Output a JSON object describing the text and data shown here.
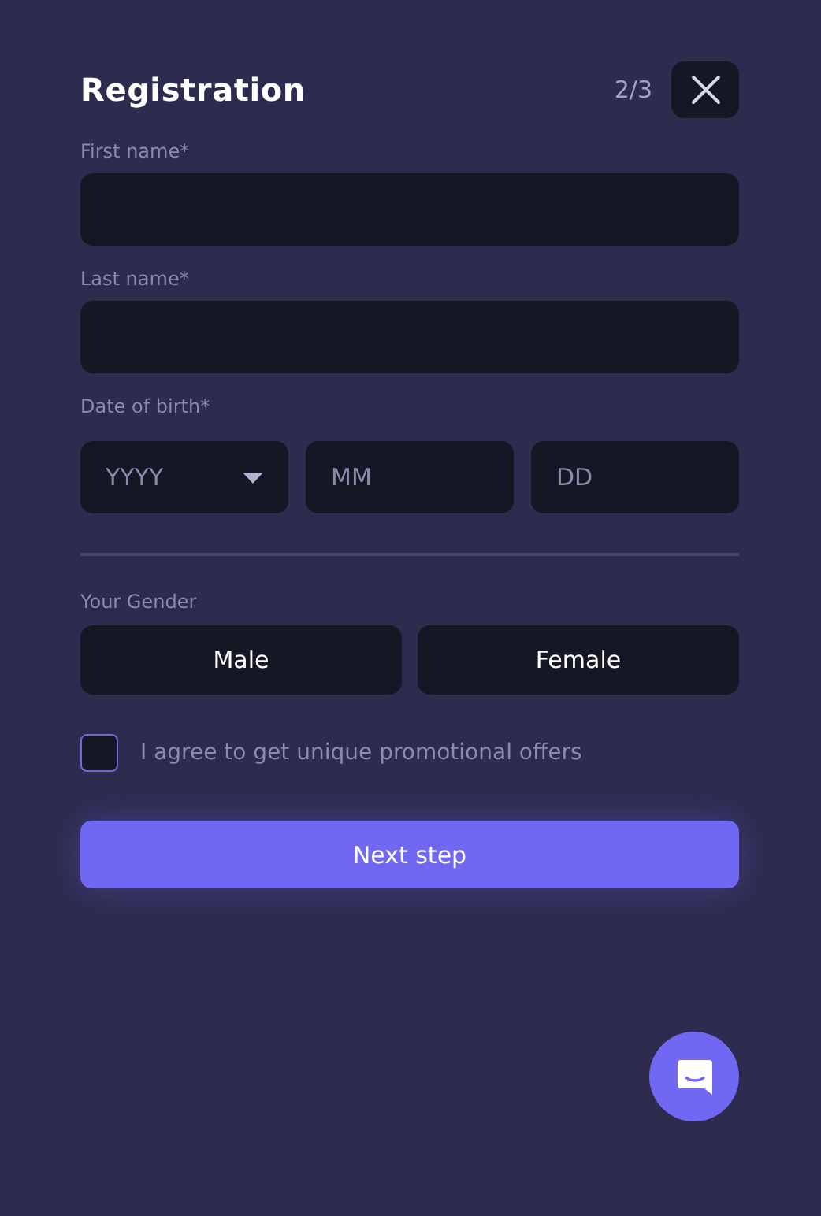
{
  "title": "Registration",
  "step": "2/3",
  "fields": [
    {
      "label": "First name*"
    },
    {
      "label": "Last name*"
    }
  ],
  "date_of_birth": {
    "label": "Date of birth*",
    "parts": [
      {
        "placeholder": "YYYY",
        "kind": "dropdown"
      },
      {
        "placeholder": "MM",
        "kind": "input"
      },
      {
        "placeholder": "DD",
        "kind": "input"
      }
    ]
  },
  "gender": {
    "label": "Your Gender",
    "options": [
      {
        "label": "Male",
        "selected": false
      },
      {
        "label": "Female",
        "selected": false
      }
    ]
  },
  "agree": {
    "label": "I agree to get unique promotional offers",
    "checked": false
  },
  "next_button": "Next step"
}
